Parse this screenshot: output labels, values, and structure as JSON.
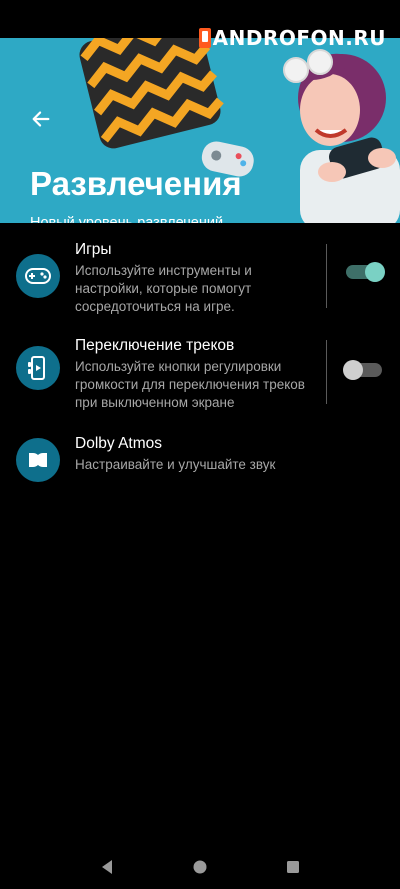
{
  "watermark": {
    "text": "ANDROFON.RU"
  },
  "header": {
    "title": "Развлечения",
    "subtitle": "Новый уровень развлечений."
  },
  "items": [
    {
      "title": "Игры",
      "description": "Используйте инструменты и настройки, которые помогут сосредоточиться на игре.",
      "icon": "gamepad-icon",
      "toggle": true
    },
    {
      "title": "Переключение треков",
      "description": "Используйте кнопки регулировки громкости для переключения треков при выключенном экране",
      "icon": "track-switch-icon",
      "toggle": false
    },
    {
      "title": "Dolby Atmos",
      "description": "Настраивайте и улучшайте звук",
      "icon": "dolby-icon",
      "toggle": null
    }
  ],
  "colors": {
    "banner": "#2ea9c5",
    "icon_bg": "#0e6f8c",
    "toggle_on_knob": "#7ad1c4",
    "toggle_on_track": "#3e6f68"
  }
}
